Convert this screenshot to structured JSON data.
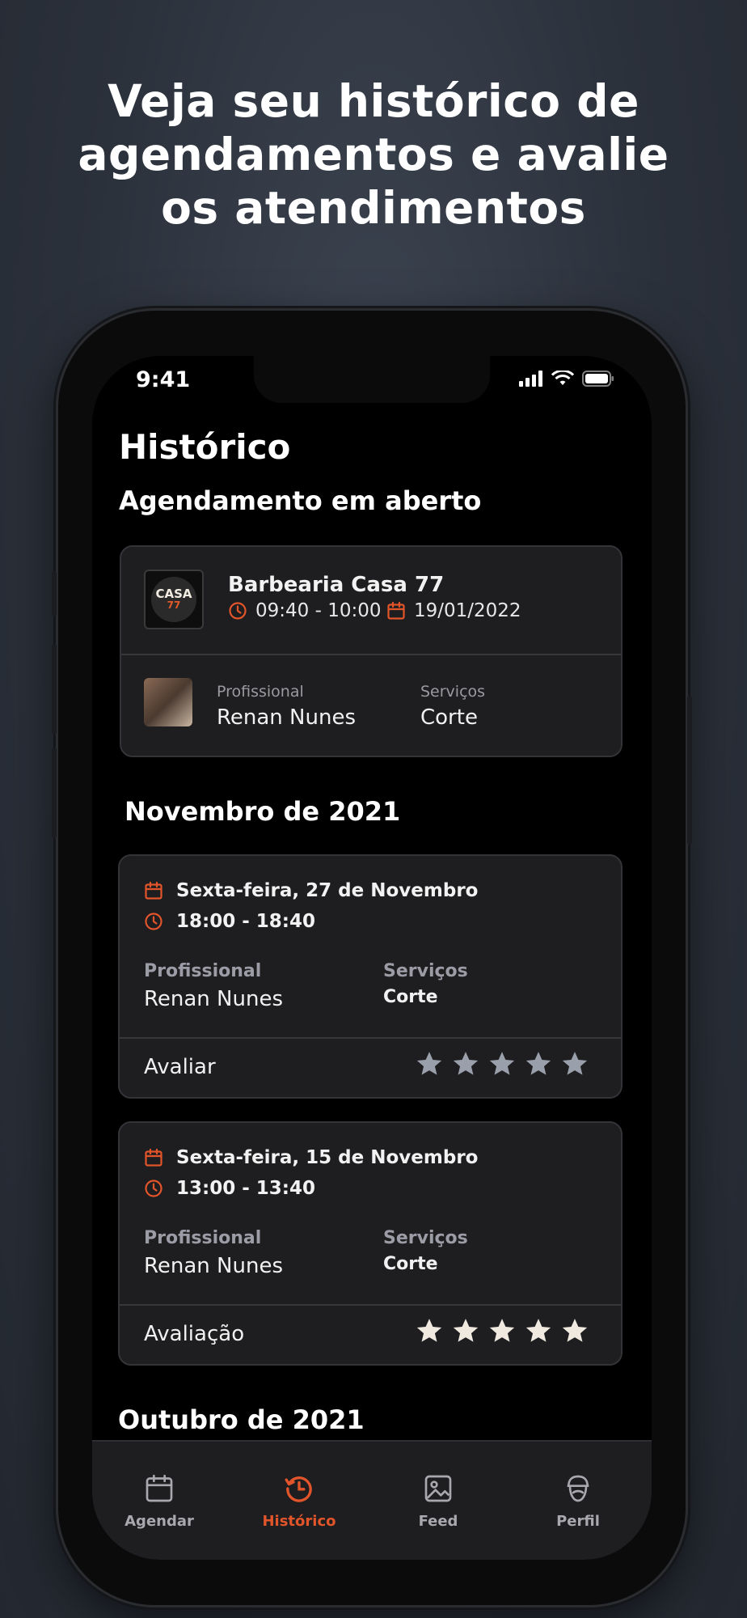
{
  "headline": [
    "Veja seu histórico de",
    "agendamentos e avalie",
    "os atendimentos"
  ],
  "status_bar": {
    "time": "9:41"
  },
  "page_title": "Histórico",
  "open_section": {
    "title": "Agendamento em aberto",
    "shop": {
      "logo_text": "CASA",
      "logo_sub": "77",
      "name": "Barbearia Casa 77",
      "time": "09:40 - 10:00",
      "date": "19/01/2022"
    },
    "professional_label": "Profissional",
    "professional": "Renan Nunes",
    "services_label": "Serviços",
    "services": "Corte"
  },
  "month_sections": [
    {
      "title": "Novembro de 2021",
      "appointments": [
        {
          "date": "Sexta-feira, 27 de Novembro",
          "time": "18:00 - 18:40",
          "professional_label": "Profissional",
          "professional": "Renan Nunes",
          "services_label": "Serviços",
          "services": "Corte",
          "rating_label": "Avaliar",
          "rating": 0
        },
        {
          "date": "Sexta-feira, 15 de Novembro",
          "time": "13:00 - 13:40",
          "professional_label": "Profissional",
          "professional": "Renan Nunes",
          "services_label": "Serviços",
          "services": "Corte",
          "rating_label": "Avaliação",
          "rating": 5
        }
      ]
    },
    {
      "title": "Outubro de 2021"
    }
  ],
  "tabbar": {
    "items": [
      {
        "label": "Agendar",
        "icon": "calendar-icon"
      },
      {
        "label": "Histórico",
        "icon": "history-icon",
        "active": true
      },
      {
        "label": "Feed",
        "icon": "image-icon"
      },
      {
        "label": "Perfil",
        "icon": "profile-icon"
      }
    ]
  },
  "colors": {
    "accent": "#e2552b",
    "card": "#1e1e20",
    "star_filled": "#efe9e0",
    "star_empty": "#9aa0ab"
  }
}
